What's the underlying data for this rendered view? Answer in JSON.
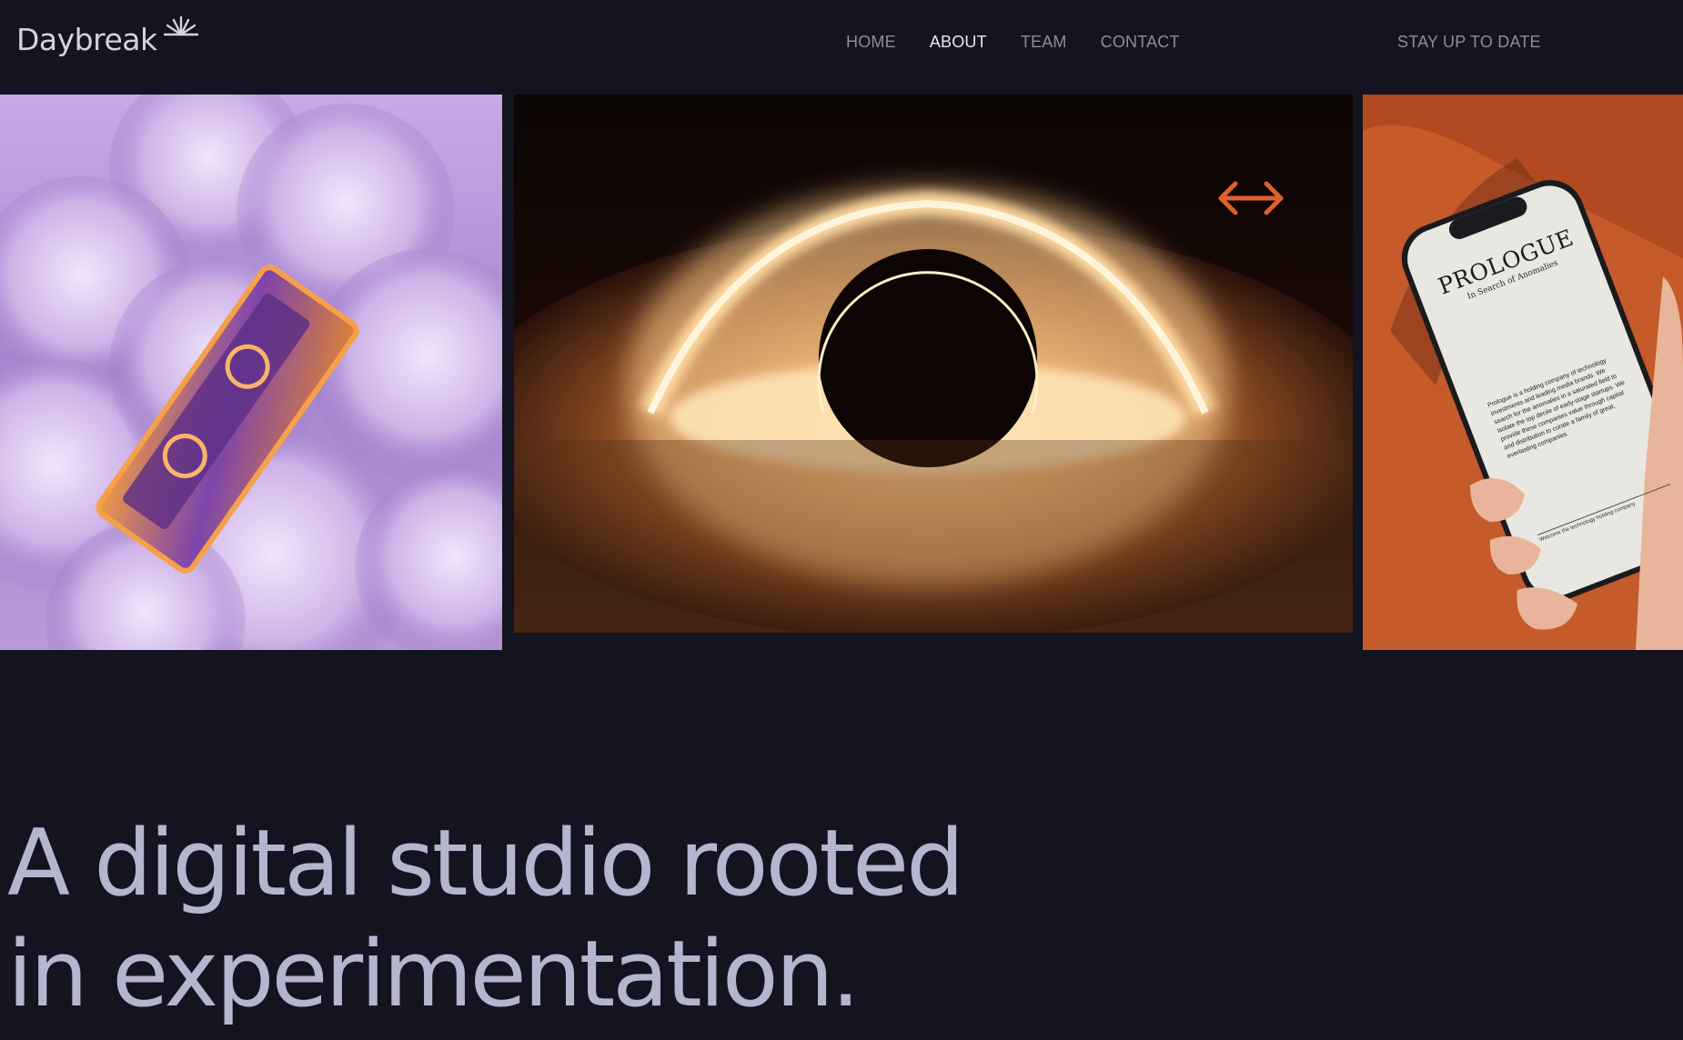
{
  "brand": {
    "name": "Daybreak",
    "logo_icon": "sunrise-rays-icon"
  },
  "nav": {
    "items": [
      {
        "label": "HOME",
        "active": false
      },
      {
        "label": "ABOUT",
        "active": true
      },
      {
        "label": "TEAM",
        "active": false
      },
      {
        "label": "CONTACT",
        "active": false
      }
    ],
    "cta_label": "STAY UP TO DATE"
  },
  "gallery": {
    "images": [
      {
        "name": "cassette-in-clouds"
      },
      {
        "name": "black-hole"
      },
      {
        "name": "prologue-phone"
      }
    ],
    "drag_icon": "double-arrow-icon",
    "phone_screen": {
      "title": "PROLOGUE",
      "subtitle": "In Search of Anomalies",
      "body": "Prologue is a holding company of technology investments and leading media brands. We search for the anomalies in a saturated field to isolate the top decile of early-stage startups. We provide these companies value through capital and distribution to curate a family of great, everlasting companies.",
      "footer": "Welcome the technology holding company"
    }
  },
  "headline": {
    "line1": "A digital studio rooted",
    "line2": "in experimentation."
  },
  "colors": {
    "background": "#13141f",
    "accent": "#e0612e",
    "headline": "#b6b5ce",
    "nav_text": "#8d8c9b",
    "nav_active": "#e9e8f0"
  }
}
